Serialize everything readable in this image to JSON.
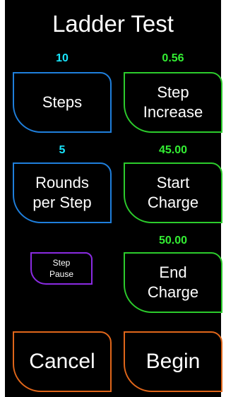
{
  "title": "Ladder Test",
  "colors": {
    "background": "#000000",
    "blue": "#1f7fdc",
    "green": "#2ccc2c",
    "purple": "#8a2be2",
    "orange": "#e0661a",
    "cyan_value": "#19e6ff",
    "green_value": "#33ee33"
  },
  "steps": {
    "value": "10",
    "label": "Steps"
  },
  "step_increase": {
    "value": "0.56",
    "label": "Step\nIncrease"
  },
  "rounds_per_step": {
    "value": "5",
    "label": "Rounds\nper Step"
  },
  "start_charge": {
    "value": "45.00",
    "label": "Start\nCharge"
  },
  "step_pause": {
    "label": "Step\nPause"
  },
  "end_charge": {
    "value": "50.00",
    "label": "End\nCharge"
  },
  "cancel": {
    "label": "Cancel"
  },
  "begin": {
    "label": "Begin"
  }
}
